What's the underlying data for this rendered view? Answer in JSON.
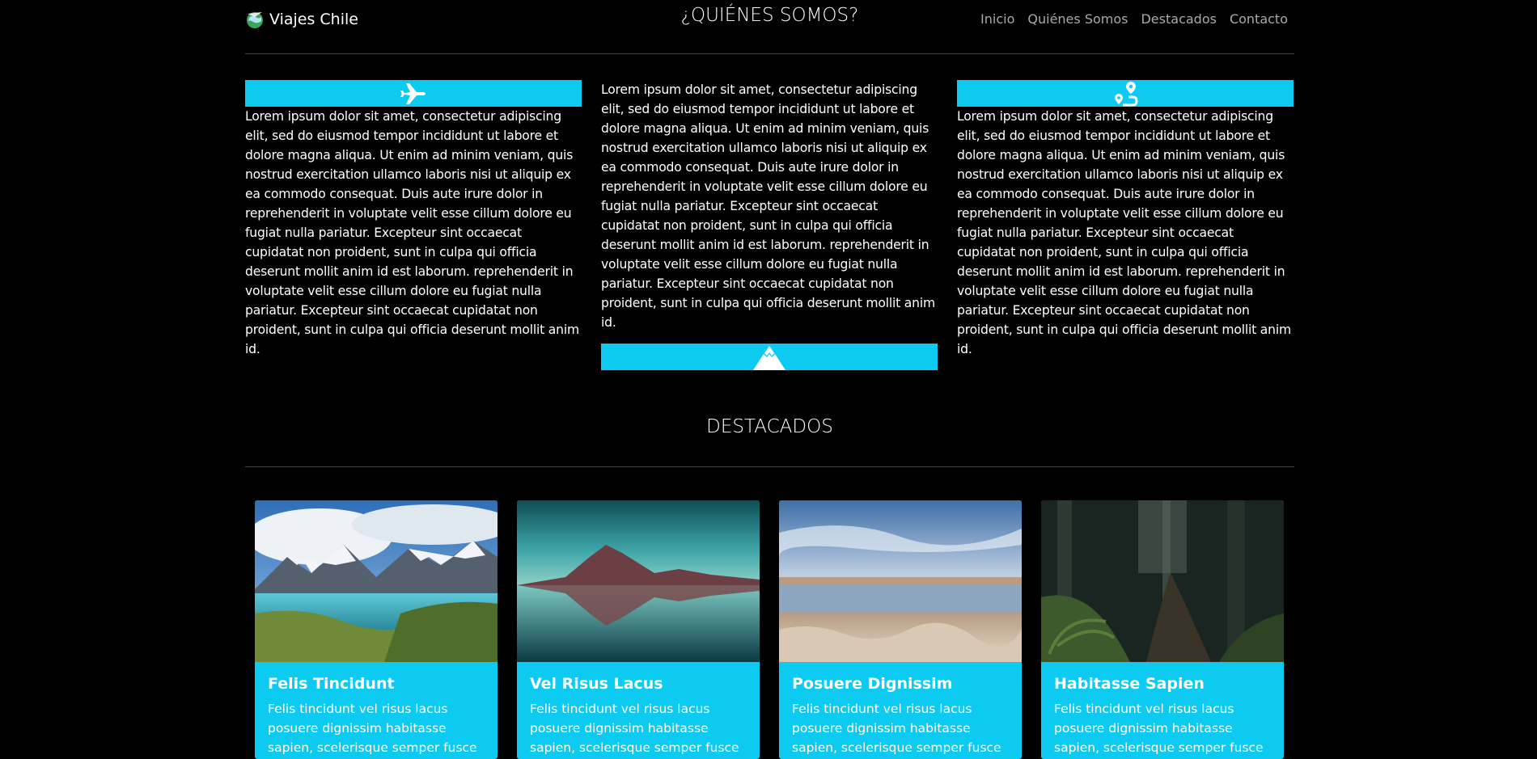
{
  "navbar": {
    "brand": "Viajes Chile",
    "section_title": "¿QUIÉNES SOMOS?",
    "links": [
      "Inicio",
      "Quiénes Somos",
      "Destacados",
      "Contacto"
    ]
  },
  "about": {
    "columns": [
      {
        "icon": "airplane-icon",
        "text": "Lorem ipsum dolor sit amet, consectetur adipiscing elit, sed do eiusmod tempor incididunt ut labore et dolore magna aliqua. Ut enim ad minim veniam, quis nostrud exercitation ullamco laboris nisi ut aliquip ex ea commodo consequat. Duis aute irure dolor in reprehenderit in voluptate velit esse cillum dolore eu fugiat nulla pariatur. Excepteur sint occaecat cupidatat non proident, sunt in culpa qui officia deserunt mollit anim id est laborum. reprehenderit in voluptate velit esse cillum dolore eu fugiat nulla pariatur. Excepteur sint occaecat cupidatat non proident, sunt in culpa qui officia deserunt mollit anim id."
      },
      {
        "icon": "mountain-icon",
        "text": "Lorem ipsum dolor sit amet, consectetur adipiscing elit, sed do eiusmod tempor incididunt ut labore et dolore magna aliqua. Ut enim ad minim veniam, quis nostrud exercitation ullamco laboris nisi ut aliquip ex ea commodo consequat. Duis aute irure dolor in reprehenderit in voluptate velit esse cillum dolore eu fugiat nulla pariatur. Excepteur sint occaecat cupidatat non proident, sunt in culpa qui officia deserunt mollit anim id est laborum. reprehenderit in voluptate velit esse cillum dolore eu fugiat nulla pariatur. Excepteur sint occaecat cupidatat non proident, sunt in culpa qui officia deserunt mollit anim id."
      },
      {
        "icon": "route-icon",
        "text": "Lorem ipsum dolor sit amet, consectetur adipiscing elit, sed do eiusmod tempor incididunt ut labore et dolore magna aliqua. Ut enim ad minim veniam, quis nostrud exercitation ullamco laboris nisi ut aliquip ex ea commodo consequat. Duis aute irure dolor in reprehenderit in voluptate velit esse cillum dolore eu fugiat nulla pariatur. Excepteur sint occaecat cupidatat non proident, sunt in culpa qui officia deserunt mollit anim id est laborum. reprehenderit in voluptate velit esse cillum dolore eu fugiat nulla pariatur. Excepteur sint occaecat cupidatat non proident, sunt in culpa qui officia deserunt mollit anim id."
      }
    ]
  },
  "destacados": {
    "title": "DESTACADOS",
    "cards": [
      {
        "title": "Felis Tincidunt",
        "text": "Felis tincidunt vel risus lacus posuere dignissim habitasse sapien, scelerisque semper fusce turpis."
      },
      {
        "title": "Vel Risus Lacus",
        "text": "Felis tincidunt vel risus lacus posuere dignissim habitasse sapien, scelerisque semper fusce turpis."
      },
      {
        "title": "Posuere Dignissim",
        "text": "Felis tincidunt vel risus lacus posuere dignissim habitasse sapien, scelerisque semper fusce turpis."
      },
      {
        "title": "Habitasse Sapien",
        "text": "Felis tincidunt vel risus lacus posuere dignissim habitasse sapien, scelerisque semper fusce turpis."
      }
    ]
  },
  "colors": {
    "accent": "#0dcaf0",
    "background": "#000000",
    "text": "#ffffff",
    "nav_link": "#aaaaaa"
  }
}
